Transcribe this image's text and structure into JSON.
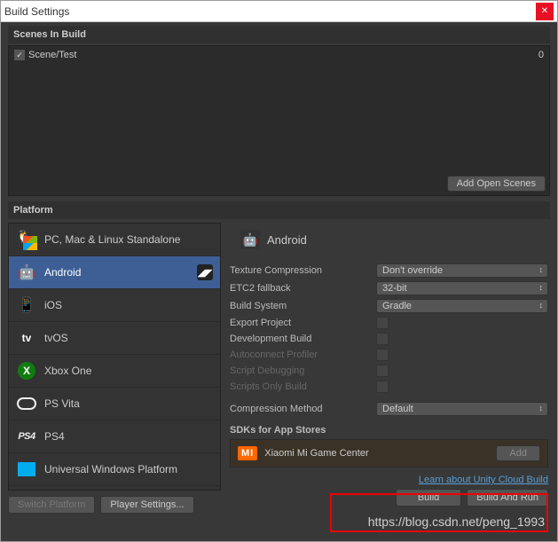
{
  "window": {
    "title": "Build Settings"
  },
  "scenes": {
    "header": "Scenes In Build",
    "items": [
      {
        "name": "Scene/Test",
        "index": "0",
        "checked": true
      }
    ],
    "add_button": "Add Open Scenes"
  },
  "platform_section": {
    "header": "Platform",
    "items": [
      {
        "id": "standalone",
        "label": "PC, Mac & Linux Standalone",
        "selected": false
      },
      {
        "id": "android",
        "label": "Android",
        "selected": true
      },
      {
        "id": "ios",
        "label": "iOS",
        "selected": false
      },
      {
        "id": "tvos",
        "label": "tvOS",
        "selected": false
      },
      {
        "id": "xboxone",
        "label": "Xbox One",
        "selected": false
      },
      {
        "id": "psvita",
        "label": "PS Vita",
        "selected": false
      },
      {
        "id": "ps4",
        "label": "PS4",
        "selected": false
      },
      {
        "id": "uwp",
        "label": "Universal Windows Platform",
        "selected": false
      }
    ],
    "switch_platform": "Switch Platform",
    "player_settings": "Player Settings..."
  },
  "details": {
    "title": "Android",
    "settings": {
      "texture_compression": {
        "label": "Texture Compression",
        "value": "Don't override"
      },
      "etc2_fallback": {
        "label": "ETC2 fallback",
        "value": "32-bit"
      },
      "build_system": {
        "label": "Build System",
        "value": "Gradle"
      },
      "export_project": {
        "label": "Export Project"
      },
      "development_build": {
        "label": "Development Build"
      },
      "autoconnect_profiler": {
        "label": "Autoconnect Profiler"
      },
      "script_debugging": {
        "label": "Script Debugging"
      },
      "scripts_only_build": {
        "label": "Scripts Only Build"
      },
      "compression_method": {
        "label": "Compression Method",
        "value": "Default"
      }
    },
    "sdk": {
      "header": "SDKs for App Stores",
      "logo_text": "MI",
      "name": "Xiaomi Mi Game Center",
      "add": "Add"
    },
    "cloud_link": "Learn about Unity Cloud Build",
    "build": "Build",
    "build_and_run": "Build And Run"
  },
  "watermark": "https://blog.csdn.net/peng_1993"
}
